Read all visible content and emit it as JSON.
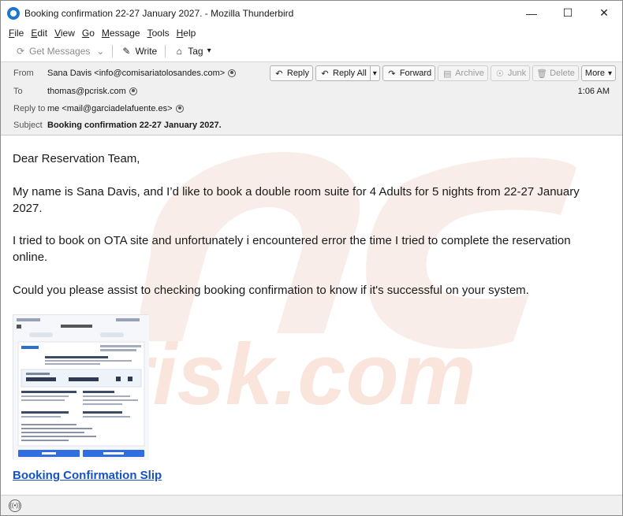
{
  "window": {
    "title": "Booking confirmation 22-27 January 2027. - Mozilla Thunderbird",
    "controls": {
      "minimize": "—",
      "maximize": "☐",
      "close": "✕"
    }
  },
  "menubar": {
    "items": [
      {
        "label_u": "F",
        "label_rest": "ile"
      },
      {
        "label_u": "E",
        "label_rest": "dit"
      },
      {
        "label_u": "V",
        "label_rest": "iew"
      },
      {
        "label_u": "G",
        "label_rest": "o"
      },
      {
        "label_u": "M",
        "label_rest": "essage"
      },
      {
        "label_u": "T",
        "label_rest": "ools"
      },
      {
        "label_u": "H",
        "label_rest": "elp"
      }
    ]
  },
  "toolbar": {
    "get_messages": "Get Messages",
    "write": "Write",
    "tag": "Tag"
  },
  "header": {
    "from_label": "From",
    "from_value": "Sana Davis <info@comisariatolosandes.com>",
    "to_label": "To",
    "to_value": "thomas@pcrisk.com",
    "reply_to_label": "Reply to",
    "reply_to_value": "me <mail@garciadelafuente.es>",
    "subject_label": "Subject",
    "subject_value": "Booking confirmation 22-27 January 2027.",
    "time": "1:06 AM",
    "actions": {
      "reply": "Reply",
      "reply_all": "Reply All",
      "forward": "Forward",
      "archive": "Archive",
      "junk": "Junk",
      "delete": "Delete",
      "more": "More"
    }
  },
  "message": {
    "greeting": "Dear Reservation Team,",
    "p1": "My name is Sana Davis, and I’d like to book a double room suite for 4 Adults for 5 nights from 22-27 January 2027.",
    "p2": "I tried to book on OTA site and unfortunately i encountered error the time I tried to complete the reservation online.",
    "p3": "Could you please assist to checking booking confirmation to know if it's successful on your system.",
    "link_text": "Booking Confirmation Slip"
  },
  "colors": {
    "accent": "#1976d2",
    "link": "#1652c4",
    "chrome_bg": "#f0f0f0",
    "watermark": "#f3d9cf"
  }
}
